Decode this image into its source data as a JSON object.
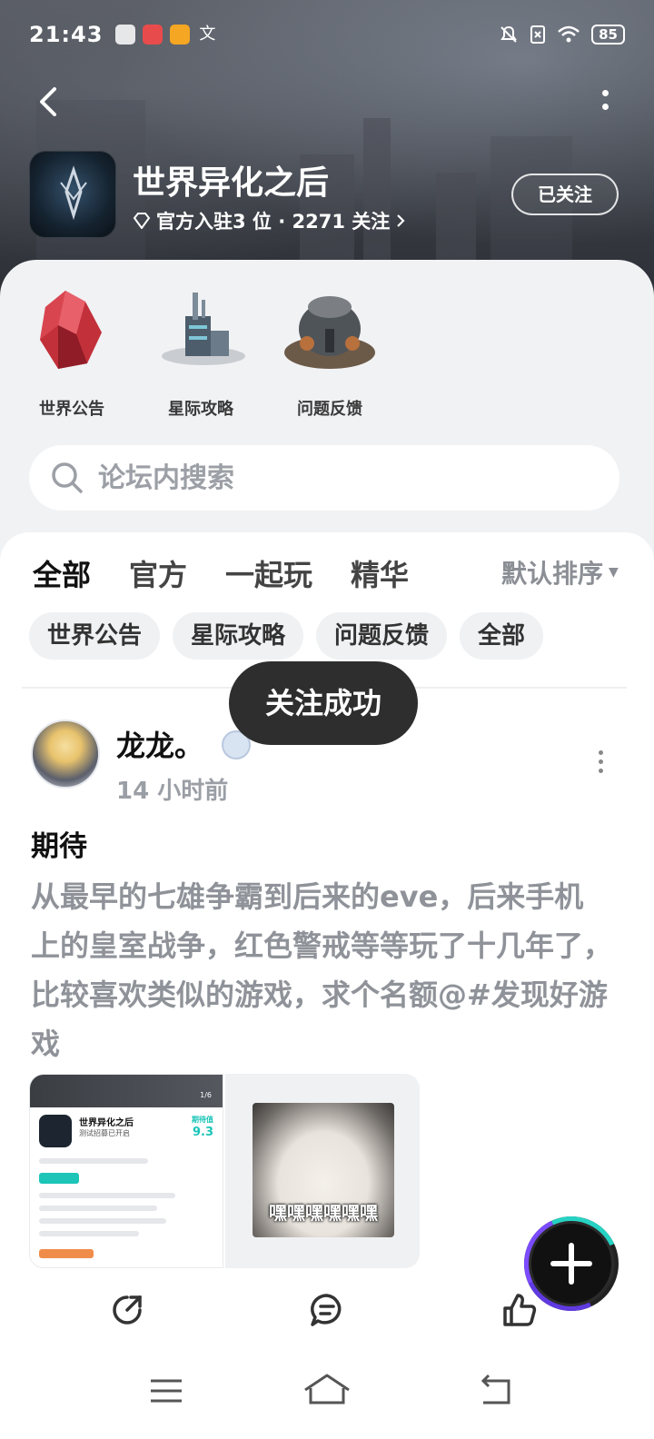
{
  "status_bar": {
    "time": "21:43",
    "battery": "85"
  },
  "header": {
    "game_title": "世界异化之后",
    "meta": "官方入驻3 位 · 2271 关注",
    "follow_label": "已关注"
  },
  "shortcuts": [
    {
      "label": "世界公告",
      "icon": "red-crystal-icon"
    },
    {
      "label": "星际攻略",
      "icon": "space-tower-icon"
    },
    {
      "label": "问题反馈",
      "icon": "station-icon"
    }
  ],
  "search": {
    "placeholder": "论坛内搜索"
  },
  "tabs": [
    {
      "label": "全部",
      "active": true
    },
    {
      "label": "官方",
      "active": false
    },
    {
      "label": "一起玩",
      "active": false
    },
    {
      "label": "精华",
      "active": false
    }
  ],
  "sort": {
    "label": "默认排序"
  },
  "chips": [
    "世界公告",
    "星际攻略",
    "问题反馈",
    "全部"
  ],
  "toast": "关注成功",
  "post": {
    "author": "龙龙。",
    "time": "14 小时前",
    "title": "期待",
    "body": "从最早的七雄争霸到后来的eve，后来手机上的皇室战争，红色警戒等等玩了十几年了，比较喜欢类似的游戏，求个名额@#发现好游戏",
    "thumb1": {
      "title": "世界异化之后",
      "subtitle": "测试招募已开启",
      "score_label": "期待值",
      "score": "9.3",
      "page": "1/6"
    },
    "thumb2": {
      "caption": "嘿嘿嘿嘿嘿嘿"
    }
  },
  "colors": {
    "accent": "#1cc5b7",
    "toast_bg": "#2e2e2e",
    "muted_text": "#8f9399"
  }
}
